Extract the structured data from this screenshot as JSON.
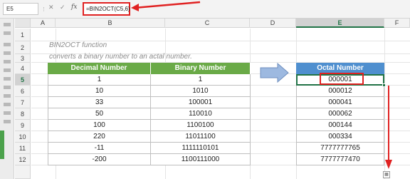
{
  "formula_bar": {
    "name_box": "E5",
    "separator": "⋮",
    "cancel_glyph": "✕",
    "enter_glyph": "✓",
    "fx_label": "fx",
    "formula": "=BIN2OCT(C5,6)"
  },
  "columns": [
    "A",
    "B",
    "C",
    "D",
    "E",
    "F"
  ],
  "rows": [
    "1",
    "2",
    "3",
    "4",
    "5",
    "6",
    "7",
    "8",
    "9",
    "10",
    "11",
    "12"
  ],
  "selected_column": "E",
  "selected_row": "5",
  "description": {
    "line1": "BIN2OCT  function",
    "line2": "converts a binary number to an actal number."
  },
  "table": {
    "headers": [
      "Decimal Number",
      "Binary Number"
    ],
    "rows": [
      [
        "1",
        "1"
      ],
      [
        "10",
        "1010"
      ],
      [
        "33",
        "100001"
      ],
      [
        "50",
        "110010"
      ],
      [
        "100",
        "1100100"
      ],
      [
        "220",
        "11011100"
      ],
      [
        "-11",
        "1111110101"
      ],
      [
        "-200",
        "1100111000"
      ]
    ]
  },
  "result": {
    "header": "Octal Number",
    "values": [
      "000001",
      "000012",
      "000041",
      "000062",
      "000144",
      "000334",
      "7777777765",
      "7777777470"
    ]
  },
  "quick_analysis_glyph": "▦",
  "colors": {
    "table_header_green": "#6aaa47",
    "result_header_blue": "#4f8fcf",
    "arrow_blue": "#9db9e0",
    "highlight_red": "#e02222",
    "excel_green": "#217346"
  }
}
